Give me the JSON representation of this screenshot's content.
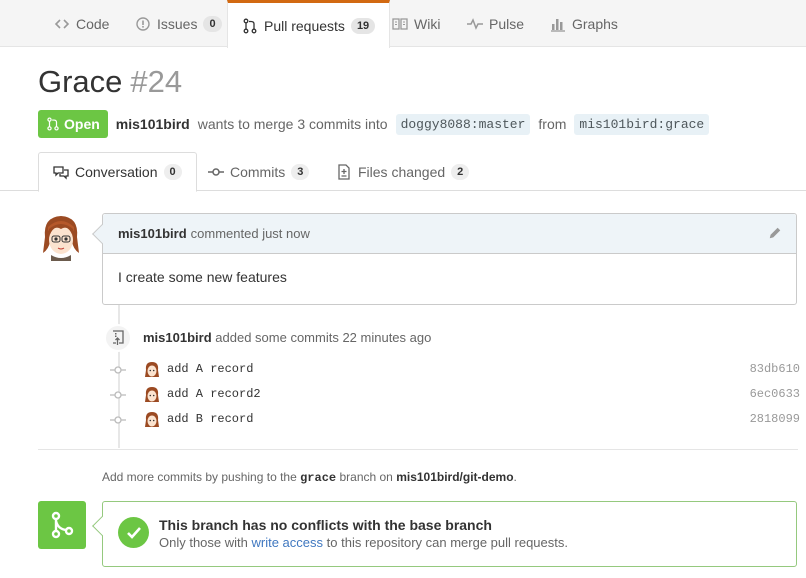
{
  "repo_nav": {
    "tabs": [
      {
        "label": "Code",
        "icon": "code-icon"
      },
      {
        "label": "Issues",
        "icon": "issue-icon",
        "count": "0"
      },
      {
        "label": "Pull requests",
        "icon": "pull-request-icon",
        "count": "19",
        "selected": true
      },
      {
        "label": "Wiki",
        "icon": "book-icon"
      },
      {
        "label": "Pulse",
        "icon": "pulse-icon"
      },
      {
        "label": "Graphs",
        "icon": "graph-icon"
      }
    ]
  },
  "pr": {
    "title": "Grace",
    "number": "#24",
    "state": "Open",
    "author": "mis101bird",
    "merge_text": "wants to merge 3 commits into",
    "base_branch": "doggy8088:master",
    "from_text": "from",
    "head_branch": "mis101bird:grace"
  },
  "tabs": [
    {
      "label": "Conversation",
      "count": "0",
      "icon": "comment-discussion-icon",
      "selected": true
    },
    {
      "label": "Commits",
      "count": "3",
      "icon": "commit-icon"
    },
    {
      "label": "Files changed",
      "count": "2",
      "icon": "diff-icon"
    }
  ],
  "comment": {
    "author": "mis101bird",
    "meta": "commented just now",
    "body": "I create some new features"
  },
  "commits_event": {
    "author": "mis101bird",
    "text": "added some commits 22 minutes ago",
    "commits": [
      {
        "message": "add A record",
        "sha": "83db610"
      },
      {
        "message": "add A record2",
        "sha": "6ec0633"
      },
      {
        "message": "add B record",
        "sha": "2818099"
      }
    ]
  },
  "hint": {
    "prefix": "Add more commits by pushing to the",
    "branch": "grace",
    "middle": "branch on",
    "repo": "mis101bird/git-demo",
    "suffix": "."
  },
  "merge": {
    "title": "This branch has no conflicts with the base branch",
    "sub_prefix": "Only those with",
    "link": "write access",
    "sub_suffix": "to this repository can merge pull requests."
  },
  "colors": {
    "open_green": "#6cc644",
    "link_blue": "#4078c0",
    "selected_tab_accent": "#d26911"
  }
}
